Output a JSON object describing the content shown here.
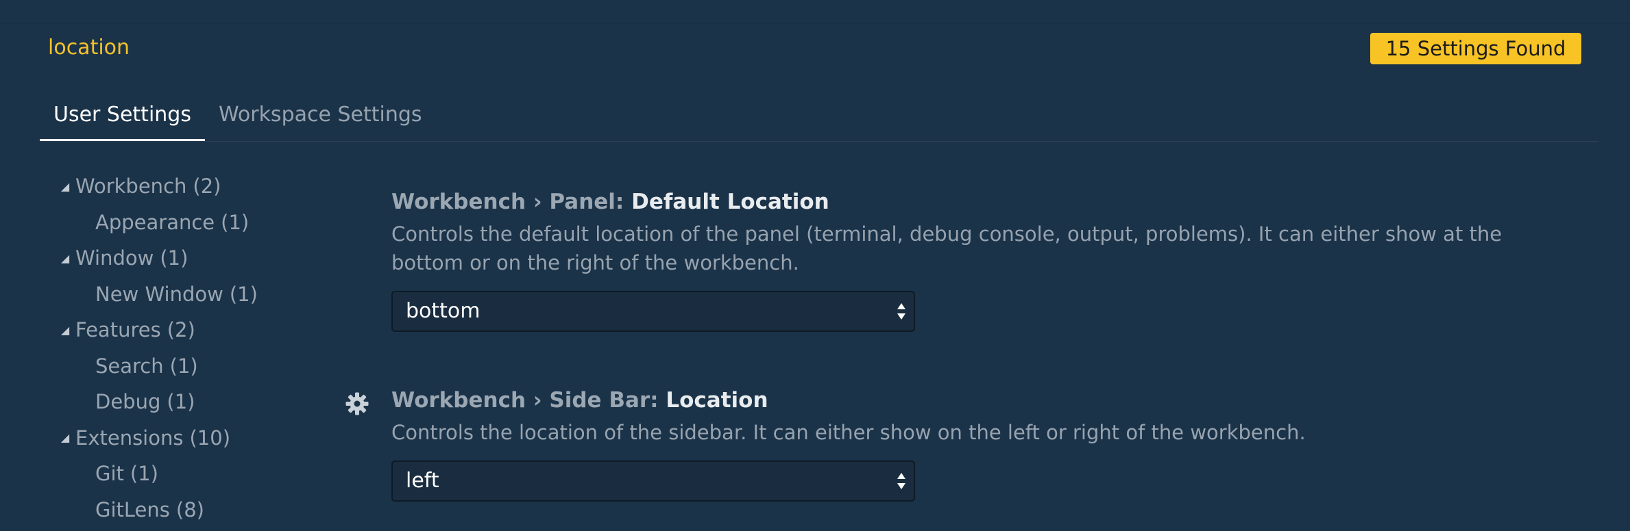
{
  "search": {
    "value": "location",
    "results_badge": "15 Settings Found"
  },
  "tabs": [
    {
      "label": "User Settings",
      "active": true
    },
    {
      "label": "Workspace Settings",
      "active": false
    }
  ],
  "toc": [
    {
      "label": "Workbench",
      "count": "(2)",
      "level": 0,
      "expanded": true
    },
    {
      "label": "Appearance",
      "count": "(1)",
      "level": 1
    },
    {
      "label": "Window",
      "count": "(1)",
      "level": 0,
      "expanded": true
    },
    {
      "label": "New Window",
      "count": "(1)",
      "level": 1
    },
    {
      "label": "Features",
      "count": "(2)",
      "level": 0,
      "expanded": true
    },
    {
      "label": "Search",
      "count": "(1)",
      "level": 1
    },
    {
      "label": "Debug",
      "count": "(1)",
      "level": 1
    },
    {
      "label": "Extensions",
      "count": "(10)",
      "level": 0,
      "expanded": true
    },
    {
      "label": "Git",
      "count": "(1)",
      "level": 1
    },
    {
      "label": "GitLens",
      "count": "(8)",
      "level": 1
    }
  ],
  "settings": [
    {
      "category": "Workbench › Panel: ",
      "name": "Default Location",
      "description": "Controls the default location of the panel (terminal, debug console, output, problems). It can either show at the bottom or on the right of the workbench.",
      "value": "bottom"
    },
    {
      "category": "Workbench › Side Bar: ",
      "name": "Location",
      "description": "Controls the location of the sidebar. It can either show on the left or right of the workbench.",
      "value": "left"
    }
  ],
  "colors": {
    "background": "#1b3349",
    "accent": "#f7c325",
    "search_text": "#f2c22b"
  },
  "icons": {
    "gear": "gear-icon",
    "twistie": "triangle-expanded-icon",
    "select_arrows": "select-arrows-icon"
  }
}
